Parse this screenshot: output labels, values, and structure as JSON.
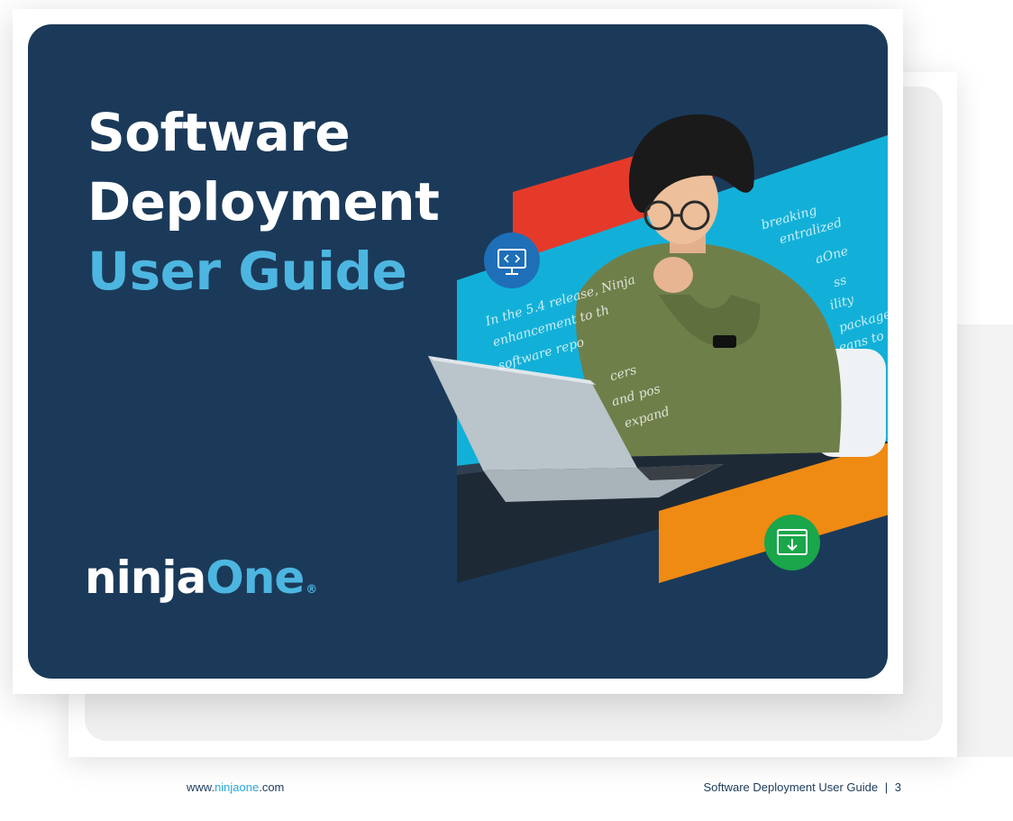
{
  "cover": {
    "title_line1": "Software",
    "title_line2": "Deployment",
    "title_line3": "User Guide",
    "handwriting": [
      "breaking",
      "entralized",
      "aOne",
      "ss",
      "In the 5.4 release, Ninja",
      "enhancement to th",
      "ility",
      "package",
      "software repo",
      "eans to",
      "cers",
      "and pos",
      "expand"
    ],
    "logo_ninja": "ninja",
    "logo_one": "One",
    "logo_reg": "®"
  },
  "icons": {
    "top": "monitor-code-icon",
    "bottom": "download-window-icon"
  },
  "colors": {
    "navy": "#1b3a5a",
    "light_blue": "#4db6e0",
    "cyan_band": "#12b0d8",
    "red_band": "#e53a2a",
    "orange_band": "#ef8a12",
    "icon_blue": "#1e6fb8",
    "icon_green": "#1aa64a"
  },
  "footer": {
    "url_prefix": "www.",
    "url_brand": "ninjaone",
    "url_suffix": ".com",
    "doc_title": "Software Deployment User Guide",
    "separator": "|",
    "page_number": "3"
  }
}
